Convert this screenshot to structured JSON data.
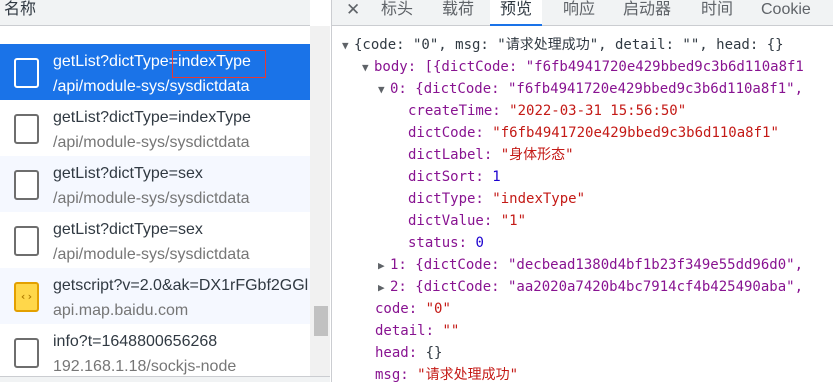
{
  "left": {
    "header": "名称",
    "requests": [
      {
        "name": "getList?dictType=indexType",
        "path": "/api/module-sys/sysdictdata",
        "icon": "document-icon",
        "selected": true
      },
      {
        "name": "getList?dictType=indexType",
        "path": "/api/module-sys/sysdictdata",
        "icon": "document-icon"
      },
      {
        "name": "getList?dictType=sex",
        "path": "/api/module-sys/sysdictdata",
        "icon": "document-icon"
      },
      {
        "name": "getList?dictType=sex",
        "path": "/api/module-sys/sysdictdata",
        "icon": "document-icon"
      },
      {
        "name": "getscript?v=2.0&ak=DX1rFGbf2GGl",
        "path": "api.map.baidu.com",
        "icon": "script-icon"
      },
      {
        "name": "info?t=1648800656268",
        "path": "192.168.1.18/sockjs-node",
        "icon": "document-icon"
      }
    ]
  },
  "tabs": {
    "close": "✕",
    "items": [
      "标头",
      "载荷",
      "预览",
      "响应",
      "启动器",
      "时间",
      "Cookie"
    ],
    "active": "预览"
  },
  "preview": {
    "root": "{code: \"0\", msg: \"请求处理成功\", detail: \"\", head: {}",
    "body_summary": "body: [{dictCode: \"f6fb4941720e429bbed9c3b6d110a8f1",
    "item0_summary": "0: {dictCode: \"f6fb4941720e429bbed9c3b6d110a8f1\",",
    "item0": {
      "createTime_key": "createTime:",
      "createTime": "\"2022-03-31 15:56:50\"",
      "dictCode_key": "dictCode:",
      "dictCode": "\"f6fb4941720e429bbed9c3b6d110a8f1\"",
      "dictLabel_key": "dictLabel:",
      "dictLabel": "\"身体形态\"",
      "dictSort_key": "dictSort:",
      "dictSort": "1",
      "dictType_key": "dictType:",
      "dictType": "\"indexType\"",
      "dictValue_key": "dictValue:",
      "dictValue": "\"1\"",
      "status_key": "status:",
      "status": "0"
    },
    "item1_summary": "1: {dictCode: \"decbead1380d4bf1b23f349e55dd96d0\",",
    "item2_summary": "2: {dictCode: \"aa2020a7420b4bc7914cf4b425490aba\",",
    "code_key": "code:",
    "code": "\"0\"",
    "detail_key": "detail:",
    "detail": "\"\"",
    "head_key": "head:",
    "head": "{}",
    "msg_key": "msg:",
    "msg": "\"请求处理成功\""
  }
}
